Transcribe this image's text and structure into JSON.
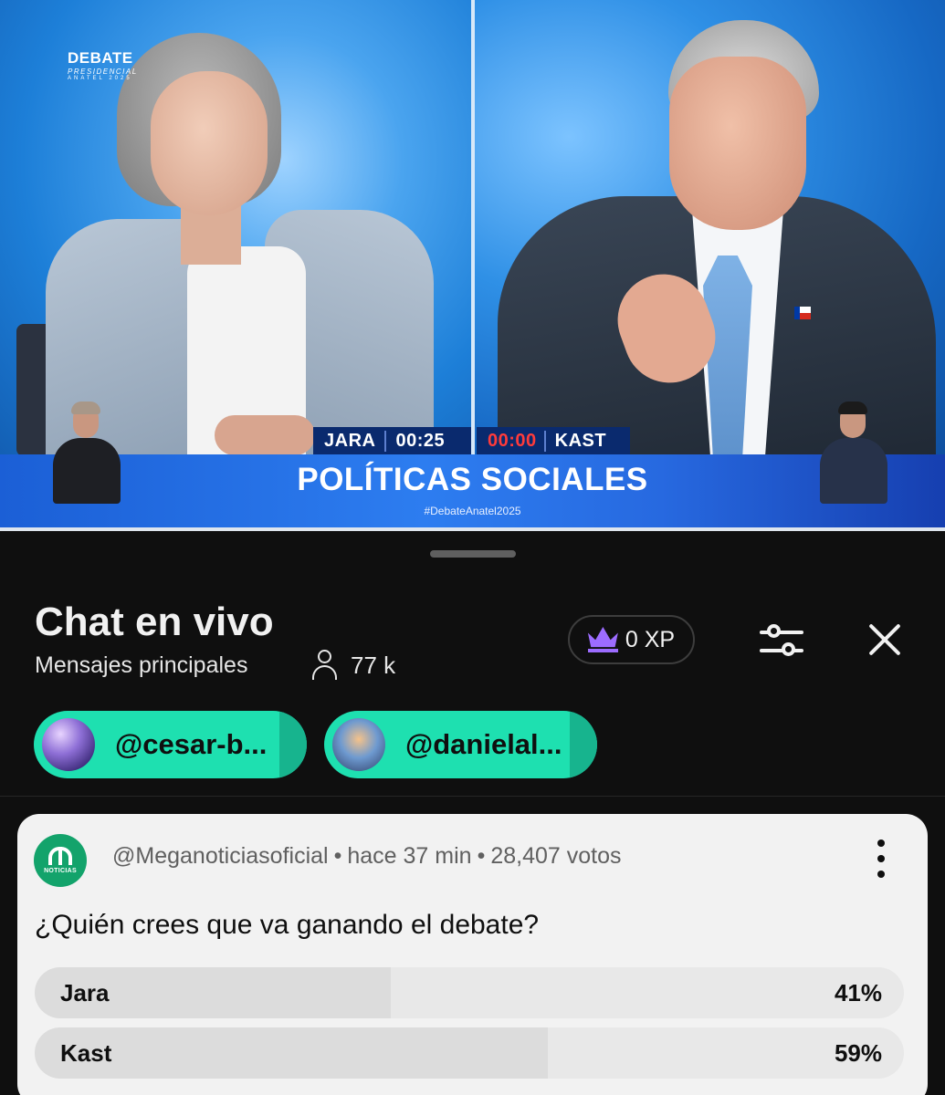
{
  "video": {
    "logo": {
      "line1": "DEBATE",
      "line2": "PRESIDENCIAL",
      "line3": "ANATEL 2025"
    },
    "left_candidate": {
      "name": "JARA",
      "timer": "00:25"
    },
    "right_candidate": {
      "name": "KAST",
      "timer": "00:00"
    },
    "banner_title": "POLÍTICAS SOCIALES",
    "hashtag": "#DebateAnatel2025"
  },
  "chat": {
    "title": "Chat en vivo",
    "subtitle": "Mensajes principales",
    "viewer_count": "77 k",
    "xp": "0 XP",
    "pinned_users": [
      {
        "label": "@cesar-b..."
      },
      {
        "label": "@danielal..."
      }
    ]
  },
  "poll": {
    "channel": "@Meganoticiasoficial",
    "channel_logo_text": "NOTICIAS",
    "time": "hace 37 min",
    "votes": "28,407 votos",
    "separator": "•",
    "question": "¿Quién crees que va ganando el debate?",
    "options": [
      {
        "label": "Jara",
        "percent_text": "41%",
        "percent": 41
      },
      {
        "label": "Kast",
        "percent_text": "59%",
        "percent": 59
      }
    ]
  },
  "colors": {
    "pill_accent": "#1ee0b0",
    "crown": "#9c6cff",
    "timer_out": "#ff3b3b"
  },
  "icons": [
    "person-icon",
    "crown-icon",
    "filter-icon",
    "close-icon",
    "more-vert-icon"
  ]
}
